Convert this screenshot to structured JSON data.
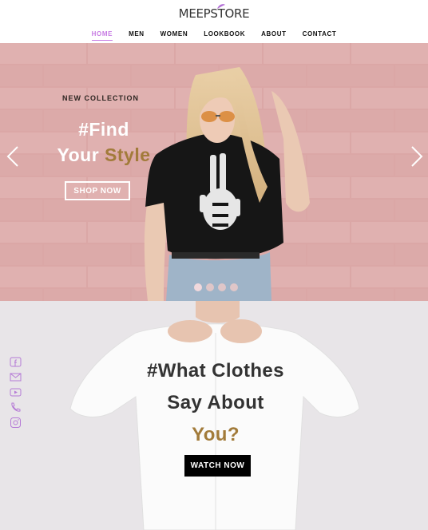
{
  "header": {
    "logo_text": "MEEPSTORE",
    "nav": [
      {
        "label": "HOME",
        "active": true
      },
      {
        "label": "MEN"
      },
      {
        "label": "WOMEN"
      },
      {
        "label": "LOOKBOOK"
      },
      {
        "label": "ABOUT"
      },
      {
        "label": "CONTACT"
      }
    ]
  },
  "hero": {
    "eyebrow": "NEW COLLECTION",
    "title_line1": "#Find",
    "title_line2_plain": "Your ",
    "title_line2_accent": "Style",
    "cta": "SHOP NOW",
    "slides_count": 4,
    "active_slide": 1,
    "colors": {
      "accent": "#a27b3a",
      "wall": "#d9a3a2"
    },
    "icons": [
      "chevron-left-icon",
      "chevron-right-icon"
    ]
  },
  "feature": {
    "title_line1": "#What Clothes",
    "title_line2": "Say About",
    "title_line3": "You?",
    "cta": "WATCH NOW",
    "social_icons": [
      "facebook-icon",
      "mail-icon",
      "youtube-icon",
      "phone-icon",
      "instagram-icon"
    ],
    "colors": {
      "accent": "#a27b3a",
      "social": "#b57ad6"
    }
  },
  "colors": {
    "nav_active": "#c77ce3"
  }
}
